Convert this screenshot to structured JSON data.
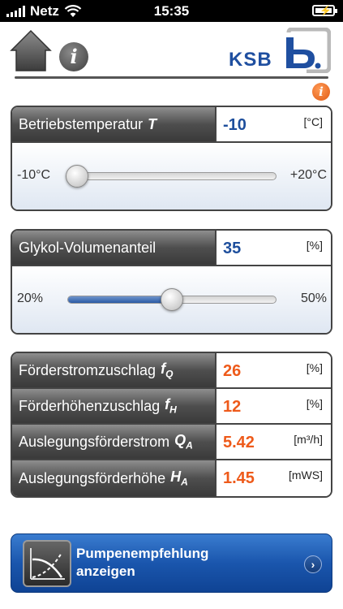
{
  "status_bar": {
    "carrier": "Netz",
    "time": "15:35"
  },
  "header": {
    "logo_text": "KSB",
    "icons": [
      "home-icon",
      "info-icon",
      "ksb-logo"
    ]
  },
  "temperature": {
    "label": "Betriebstemperatur",
    "symbol": "T",
    "value": "-10",
    "unit": "[°C]",
    "min_label": "-10°C",
    "max_label": "+20°C",
    "slider_fraction": 0.0
  },
  "glycol": {
    "label": "Glykol-Volumenanteil",
    "value": "35",
    "unit": "[%]",
    "min_label": "20%",
    "max_label": "50%",
    "slider_fraction": 0.5
  },
  "results": [
    {
      "label": "Förderstromzuschlag",
      "symbol": "f",
      "sub": "Q",
      "value": "26",
      "unit": "[%]"
    },
    {
      "label": "Förderhöhenzuschlag",
      "symbol": "f",
      "sub": "H",
      "value": "12",
      "unit": "[%]"
    },
    {
      "label": "Auslegungsförderstrom",
      "symbol": "Q",
      "sub": "A",
      "value": "5.42",
      "unit": "[m³/h]"
    },
    {
      "label": "Auslegungsförderhöhe",
      "symbol": "H",
      "sub": "A",
      "value": "1.45",
      "unit": "[mWS]"
    }
  ],
  "cta": {
    "line1": "Pumpenempfehlung",
    "line2": "anzeigen"
  },
  "colors": {
    "accent_blue": "#1d4e9c",
    "result_orange": "#ee5a1a",
    "info_orange": "#e05a14"
  }
}
